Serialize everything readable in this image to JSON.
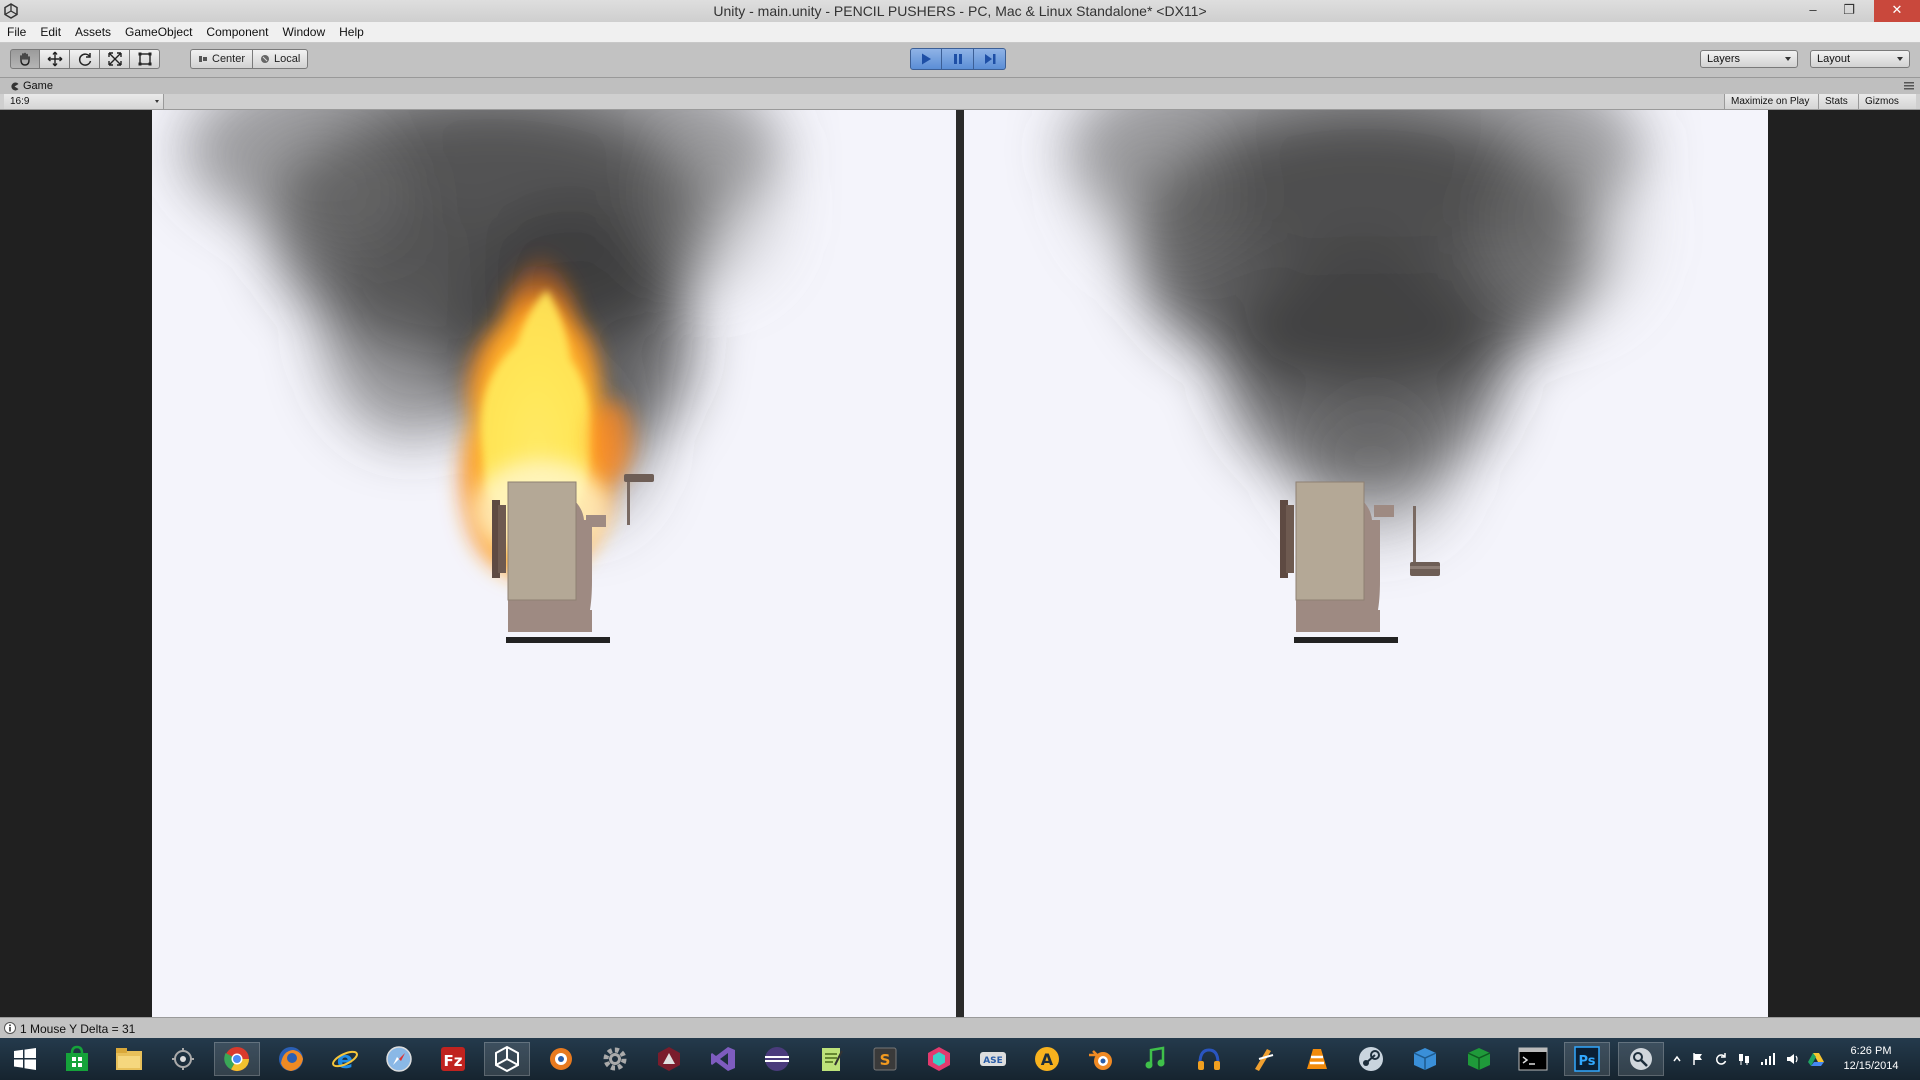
{
  "window": {
    "title": "Unity - main.unity - PENCIL PUSHERS - PC, Mac & Linux Standalone* <DX11>",
    "minimize_glyph": "–",
    "restore_glyph": "❐",
    "close_glyph": "✕"
  },
  "menu": {
    "items": [
      "File",
      "Edit",
      "Assets",
      "GameObject",
      "Component",
      "Window",
      "Help"
    ]
  },
  "toolbar": {
    "transform_tools": [
      "hand-icon",
      "move-icon",
      "rotate-icon",
      "scale-icon",
      "rect-icon"
    ],
    "pivot_mode_label": "Center",
    "pivot_rotation_label": "Local",
    "layers_label": "Layers",
    "layout_label": "Layout",
    "play_state": "playing"
  },
  "game_view": {
    "tab_label": "Game",
    "aspect_label": "16:9",
    "maximize_label": "Maximize on Play",
    "stats_label": "Stats",
    "gizmos_label": "Gizmos"
  },
  "scene": {
    "left": {
      "smoke": true,
      "fire": true,
      "handle": "up"
    },
    "right": {
      "smoke": true,
      "fire": false,
      "handle": "down"
    },
    "colors": {
      "background": "#f4f4fb",
      "sharpener_body": "#9e8a82",
      "sharpener_drum": "#b4a896",
      "sharpener_side": "#5e4a42",
      "base_plate": "#222222"
    }
  },
  "status": {
    "message": "1 Mouse Y Delta = 31"
  },
  "taskbar": {
    "apps": [
      "windows-start-icon",
      "store-icon",
      "file-explorer-icon",
      "bridge-icon",
      "chrome-icon",
      "firefox-icon",
      "internet-explorer-icon",
      "safari-icon",
      "filezilla-icon",
      "unity-icon",
      "blender-game-icon",
      "settings-icon",
      "3dsmax-icon",
      "visual-studio-icon",
      "eclipse-icon",
      "notepad-icon",
      "sublime-icon",
      "hex-tool-icon",
      "ase-icon",
      "autodesk-icon",
      "blender-icon",
      "lmms-icon",
      "audacity-icon",
      "fl-studio-icon",
      "vlc-icon",
      "steam-icon",
      "box-icon",
      "excel-box-icon",
      "command-prompt-icon",
      "photoshop-icon",
      "git-icon"
    ],
    "running_index": [
      4,
      9,
      29,
      30
    ],
    "clock_time": "6:26 PM",
    "clock_date": "12/15/2014"
  }
}
